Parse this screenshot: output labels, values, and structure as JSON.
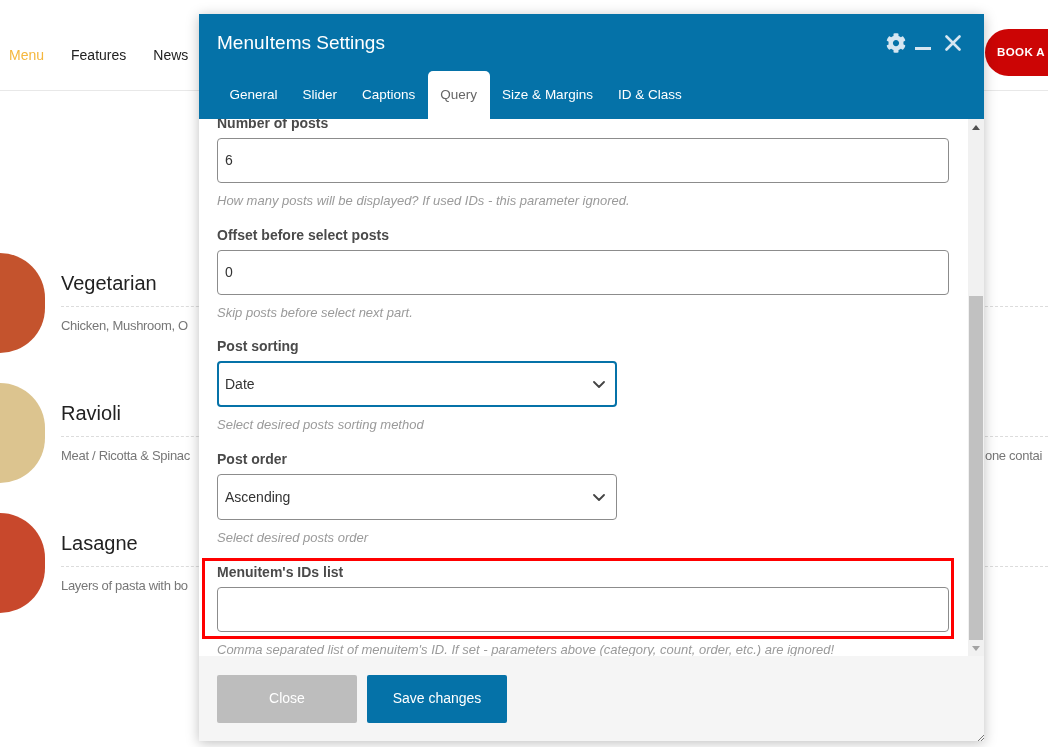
{
  "site_header": {
    "nav": [
      {
        "label": "Menu",
        "selected": true
      },
      {
        "label": "Features",
        "selected": false
      },
      {
        "label": "News",
        "selected": false
      }
    ],
    "cta": "BOOK A"
  },
  "menu_items": [
    {
      "title": "Vegetarian",
      "description": "Chicken, Mushroom, O"
    },
    {
      "title": "Ravioli",
      "description": "Meat / Ricotta & Spinac",
      "description_tail": "one contai"
    },
    {
      "title": "Lasagne",
      "description": "Layers of pasta with bo"
    }
  ],
  "dialog": {
    "title": "MenuItems Settings",
    "tabs": [
      {
        "label": "General",
        "selected": false
      },
      {
        "label": "Slider",
        "selected": false
      },
      {
        "label": "Captions",
        "selected": false
      },
      {
        "label": "Query",
        "selected": true
      },
      {
        "label": "Size & Margins",
        "selected": false
      },
      {
        "label": "ID & Class",
        "selected": false
      }
    ],
    "fields": [
      {
        "label": "Number of posts",
        "kind": "text",
        "value": "6",
        "help": "How many posts will be displayed? If used IDs - this parameter ignored.",
        "focused": false,
        "highlighted": false
      },
      {
        "label": "Offset before select posts",
        "kind": "text",
        "value": "0",
        "help": "Skip posts before select next part.",
        "focused": false,
        "highlighted": false
      },
      {
        "label": "Post sorting",
        "kind": "select",
        "value": "Date",
        "help": "Select desired posts sorting method",
        "focused": true,
        "highlighted": false
      },
      {
        "label": "Post order",
        "kind": "select",
        "value": "Ascending",
        "help": "Select desired posts order",
        "focused": false,
        "highlighted": false
      },
      {
        "label": "Menuitem's IDs list",
        "kind": "text",
        "help": "Comma separated list of menuitem's ID. If set - parameters above (category, count, order, etc.) are ignored!",
        "focused": false,
        "highlighted": true
      }
    ],
    "buttons": [
      {
        "label": "Close",
        "kind": "secondary"
      },
      {
        "label": "Save changes",
        "kind": "primary"
      }
    ]
  }
}
